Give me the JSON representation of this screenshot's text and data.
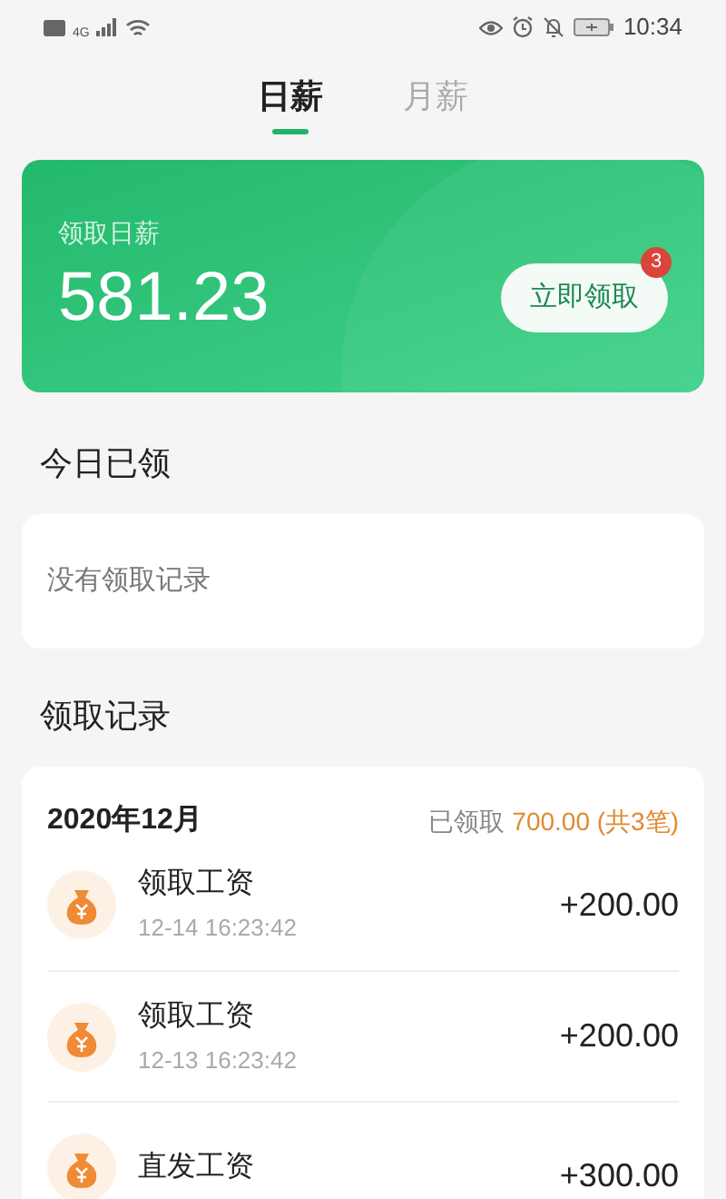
{
  "status_bar": {
    "time": "10:34",
    "network": "4G"
  },
  "tabs": [
    {
      "label": "日薪",
      "selected": true
    },
    {
      "label": "月薪",
      "selected": false
    }
  ],
  "salary_card": {
    "label": "领取日薪",
    "amount": "581.23",
    "button": "立即领取",
    "badge": "3"
  },
  "today": {
    "title": "今日已领",
    "empty_text": "没有领取记录"
  },
  "records": {
    "title": "领取记录",
    "month": "2020年12月",
    "summary_label": "已领取",
    "summary_value": "700.00 (共3笔)",
    "items": [
      {
        "title": "领取工资",
        "time": "12-14 16:23:42",
        "amount": "+200.00"
      },
      {
        "title": "领取工资",
        "time": "12-13 16:23:42",
        "amount": "+200.00"
      },
      {
        "title": "直发工资",
        "amount": "+300.00"
      }
    ]
  }
}
